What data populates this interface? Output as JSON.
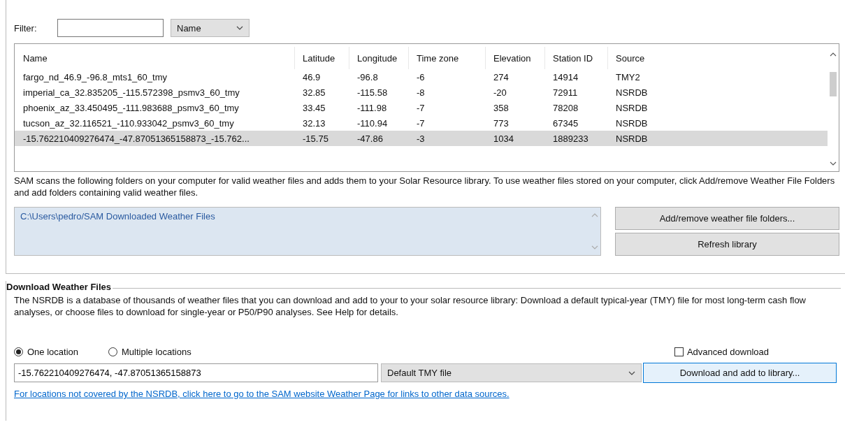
{
  "filter": {
    "label": "Filter:",
    "field": "Name"
  },
  "table": {
    "columns": [
      "Name",
      "Latitude",
      "Longitude",
      "Time zone",
      "Elevation",
      "Station ID",
      "Source"
    ],
    "rows": [
      {
        "cells": [
          "fargo_nd_46.9_-96.8_mts1_60_tmy",
          "46.9",
          "-96.8",
          "-6",
          "274",
          "14914",
          "TMY2"
        ],
        "selected": false
      },
      {
        "cells": [
          "imperial_ca_32.835205_-115.572398_psmv3_60_tmy",
          "32.85",
          "-115.58",
          "-8",
          "-20",
          "72911",
          "NSRDB"
        ],
        "selected": false
      },
      {
        "cells": [
          "phoenix_az_33.450495_-111.983688_psmv3_60_tmy",
          "33.45",
          "-111.98",
          "-7",
          "358",
          "78208",
          "NSRDB"
        ],
        "selected": false
      },
      {
        "cells": [
          "tucson_az_32.116521_-110.933042_psmv3_60_tmy",
          "32.13",
          "-110.94",
          "-7",
          "773",
          "67345",
          "NSRDB"
        ],
        "selected": false
      },
      {
        "cells": [
          "-15.762210409276474_-47.87051365158873_-15.762...",
          "-15.75",
          "-47.86",
          "-3",
          "1034",
          "1889233",
          "NSRDB"
        ],
        "selected": true
      }
    ]
  },
  "library": {
    "description": "SAM scans the following folders on your computer for valid weather files and adds them to your Solar Resource library. To use weather files stored on your computer, click Add/remove Weather File Folders and add folders containing valid weather files.",
    "folders": [
      "C:\\Users\\pedro/SAM Downloaded Weather Files"
    ],
    "buttons": [
      "Add/remove weather file folders...",
      "Refresh library"
    ]
  },
  "download": {
    "title": "Download Weather Files",
    "description": "The NSRDB is a database of thousands of weather files that you can download and add to your to your solar resource library: Download a default typical-year (TMY) file for most long-term cash flow analyses, or choose files to download for single-year or P50/P90 analyses. See Help for details.",
    "modes": [
      {
        "label": "One location",
        "selected": true
      },
      {
        "label": "Multiple locations",
        "selected": false
      }
    ],
    "advanced": {
      "label": "Advanced download",
      "checked": false
    },
    "location": "-15.762210409276474, -47.87051365158873",
    "file_type": "Default TMY file",
    "button": "Download and add to library...",
    "link": "For locations not covered by the NSRDB, click here to go to the SAM website Weather Page for links to other data sources."
  }
}
